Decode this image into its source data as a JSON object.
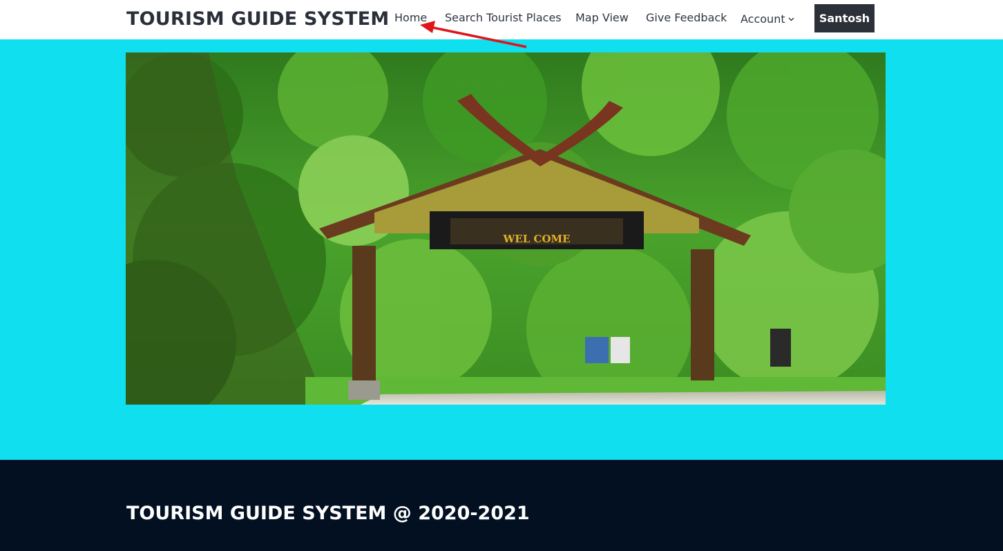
{
  "header": {
    "brand": "TOURISM GUIDE SYSTEM",
    "nav": {
      "home": "Home",
      "search": "Search Tourist Places",
      "map": "Map View",
      "feedback": "Give Feedback",
      "account": "Account"
    },
    "user": "Santosh"
  },
  "hero": {
    "sign_text": "WEL COME"
  },
  "footer": {
    "text": "TOURISM GUIDE SYSTEM @ 2020-2021"
  },
  "colors": {
    "page_background": "#0fdfee",
    "header_background": "#ffffff",
    "footer_background": "#021022",
    "user_button": "#2c3038",
    "annotation_arrow": "#e0141b"
  },
  "icons": {
    "account_dropdown": "chevron-down-icon"
  }
}
